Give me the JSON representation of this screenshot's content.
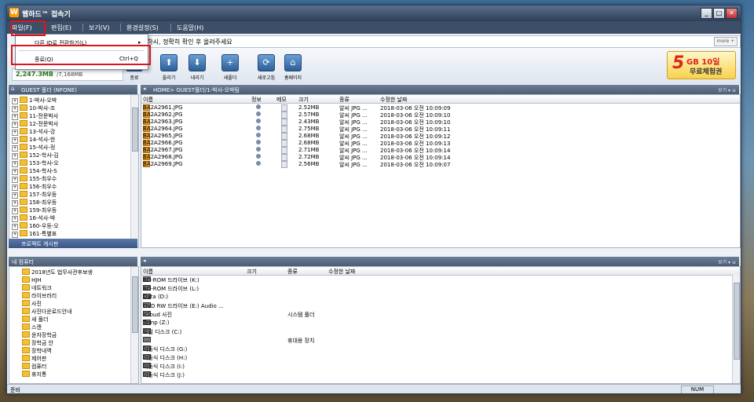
{
  "app": {
    "title": "웹하드™ 접속기",
    "icon_letter": "W"
  },
  "window_buttons": {
    "minimize": "_",
    "maximize": "□",
    "close": "✕"
  },
  "menu": [
    "파일(F)",
    "편집(E)",
    "보기(V)",
    "환경설정(S)",
    "도움말(H)"
  ],
  "file_menu": {
    "items": [
      {
        "label": "다른 ID로 전환하기(L)",
        "arrow": "▸"
      },
      {
        "label": "종료(Q)",
        "shortcut": "Ctrl+Q"
      }
    ]
  },
  "notice": {
    "text": "거하시, 정확히 확인 후 올려주세요",
    "more_label": "more +"
  },
  "usage": {
    "used": "2,247.3MB",
    "total": "/7,168MB"
  },
  "toolbar": [
    {
      "label": "종료",
      "icon": "exit-icon",
      "glyph": "⏻"
    },
    {
      "label": "올리기",
      "icon": "upload-icon",
      "glyph": "⬆"
    },
    {
      "label": "내리기",
      "icon": "download-icon",
      "glyph": "⬇"
    },
    {
      "label": "새폴더",
      "icon": "new-folder-icon",
      "glyph": "+"
    },
    {
      "label": "새로고침",
      "icon": "refresh-icon",
      "glyph": "⟳"
    },
    {
      "label": "홈페이지",
      "icon": "home-icon",
      "glyph": "⌂"
    }
  ],
  "promo": {
    "num": "5",
    "gb": "GB 10일",
    "free": "무료체험권"
  },
  "left_top": {
    "title": "GUEST 폴더 (NFONE)",
    "folders": [
      "1-박사-오박",
      "10-박사-조",
      "11-전문박사",
      "12-전문박사",
      "13-석사-강",
      "14-석사-한",
      "15-석사-정",
      "152-학사-김",
      "153-학사-오",
      "154-학사-S",
      "155-최우수",
      "156-최우수",
      "157-최우등",
      "158-최우등",
      "159-최우등",
      "16-석사-박",
      "160-우등-오",
      "161-특별표"
    ],
    "footer": "프로젝트 게시판"
  },
  "right_top": {
    "path": "HOME> GUEST폴더/1-박사-오박팀",
    "view_label": "보기 ▾ ≡",
    "columns": [
      "이름",
      "정보",
      "메모",
      "크기",
      "종류",
      "수정한 날짜"
    ],
    "files": [
      {
        "name": "BA2A2961.JPG",
        "size": "2.52MB",
        "type": "알씨 JPG ...",
        "date": "2018-03-06 오전 10:09:09"
      },
      {
        "name": "BA2A2962.JPG",
        "size": "2.57MB",
        "type": "알씨 JPG ...",
        "date": "2018-03-06 오전 10:09:10"
      },
      {
        "name": "BA2A2963.JPG",
        "size": "2.43MB",
        "type": "알씨 JPG ...",
        "date": "2018-03-06 오전 10:09:10"
      },
      {
        "name": "BA2A2964.JPG",
        "size": "2.75MB",
        "type": "알씨 JPG ...",
        "date": "2018-03-06 오전 10:09:11"
      },
      {
        "name": "BA2A2965.JPG",
        "size": "2.68MB",
        "type": "알씨 JPG ...",
        "date": "2018-03-06 오전 10:09:12"
      },
      {
        "name": "BA2A2966.JPG",
        "size": "2.68MB",
        "type": "알씨 JPG ...",
        "date": "2018-03-06 오전 10:09:13"
      },
      {
        "name": "BA2A2967.JPG",
        "size": "2.71MB",
        "type": "알씨 JPG ...",
        "date": "2018-03-06 오전 10:09:14"
      },
      {
        "name": "BA2A2968.JPG",
        "size": "2.72MB",
        "type": "알씨 JPG ...",
        "date": "2018-03-06 오전 10:09:14"
      },
      {
        "name": "BA2A2969.JPG",
        "size": "2.56MB",
        "type": "알씨 JPG ...",
        "date": "2018-03-06 오전 10:09:07"
      }
    ]
  },
  "left_bottom": {
    "title": "내 컴퓨터",
    "items": [
      "2018년도 법무사관후보생",
      "HJH",
      "네트워크",
      "라이브러리",
      "사진",
      "사진다운로드안내",
      "새 폴더",
      "스캔",
      "윤자장학금",
      "장학금 안",
      "장학내역",
      "제어판",
      "컴퓨터",
      "휴지통"
    ]
  },
  "right_bottom": {
    "view_label": "보기 ▾ ≡",
    "columns": [
      "이름",
      "크기",
      "종류",
      "수정한 날짜"
    ],
    "items": [
      {
        "name": "BD-ROM 드라이브 (K:)",
        "type": ""
      },
      {
        "name": "BD-ROM 드라이브 (L:)",
        "type": ""
      },
      {
        "name": "Data (D:)",
        "type": ""
      },
      {
        "name": "DVD RW 드라이브 (E:) Audio ...",
        "type": ""
      },
      {
        "name": "iCloud 사진",
        "type": "시스템 폴더"
      },
      {
        "name": "Temp (Z:)",
        "type": ""
      },
      {
        "name": "로컬 디스크 (C:)",
        "type": ""
      },
      {
        "name": "",
        "type": "휴대용 장치"
      },
      {
        "name": "이동식 디스크 (G:)",
        "type": ""
      },
      {
        "name": "이동식 디스크 (H:)",
        "type": ""
      },
      {
        "name": "이동식 디스크 (I:)",
        "type": ""
      },
      {
        "name": "이동식 디스크 (J:)",
        "type": ""
      }
    ]
  },
  "status": {
    "left": "준비",
    "right": "NUM"
  },
  "colors": {
    "highlight": "#e0121b",
    "title_bar": "#2d3f57",
    "menu_bar": "#3d4f68"
  }
}
